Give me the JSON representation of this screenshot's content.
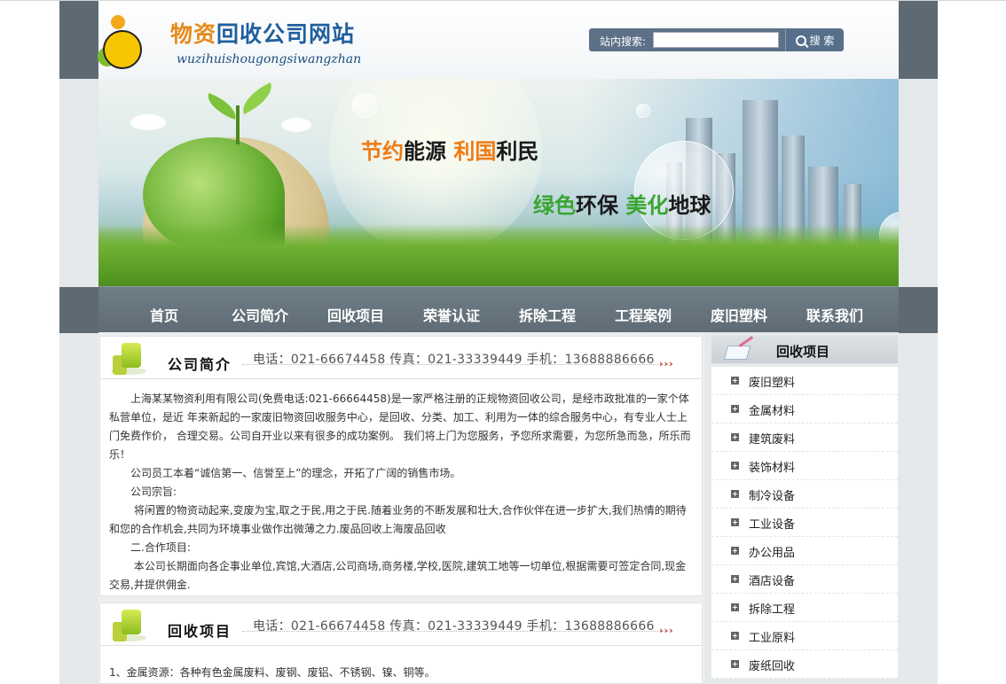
{
  "header": {
    "title_part1": "物资",
    "title_part2": "回收公司网站",
    "pinyin": "wuzihuishougongsiwangzhan",
    "search_label": "站内搜索:",
    "search_value": "",
    "search_button": "搜 索"
  },
  "banner": {
    "slogan1_a": "节约",
    "slogan1_b": "能源 ",
    "slogan1_c": "利国",
    "slogan1_d": "利民",
    "slogan2_a": "绿色",
    "slogan2_b": "环保 ",
    "slogan2_c": "美化",
    "slogan2_d": "地球"
  },
  "nav": {
    "items": [
      "首页",
      "公司简介",
      "回收项目",
      "荣誉认证",
      "拆除工程",
      "工程案例",
      "废旧塑料",
      "联系我们"
    ]
  },
  "about": {
    "title": "公司简介",
    "contact": "电话：021-66674458 传真：021-33339449 手机：13688886666",
    "arrows": "›››",
    "paragraphs": [
      "　　上海某某物资利用有限公司(免费电话:021-66664458)是一家严格注册的正规物资回收公司，是经市政批准的一家个体私营单位，是近 年来新起的一家废旧物资回收服务中心，是回收、分类、加工、利用为一体的综合服务中心，有专业人士上门免费作价， 合理交易。公司自开业以来有很多的成功案例。 我们将上门为您服务，予您所求需要，为您所急而急，所乐而乐！",
      "　　公司员工本着“诚信第一、信誉至上”的理念，开拓了广阔的销售市场。",
      "　　公司宗旨:",
      "　　 将闲置的物资动起来,变废为宝,取之于民,用之于民.随着业务的不断发展和壮大,合作伙伴在进一步扩大,我们热情的期待和您的合作机会,共同为环境事业做作出微薄之力.废品回收上海废品回收",
      "　　二.合作项目:",
      "　　 本公司长期面向各企事业单位,宾馆,大酒店,公司商场,商务楼,学校,医院,建筑工地等一切单位,根据需要可签定合同,现金交易,并提供佣金."
    ]
  },
  "projects": {
    "title": "回收项目",
    "contact": "电话：021-66674458 传真：021-33339449 手机：13688886666",
    "arrows": "›››",
    "line1": "1、金属资源：各种有色金属废料、废钢、废铝、不锈钢、镍、铜等。"
  },
  "sidebar": {
    "title": "回收项目",
    "items": [
      "废旧塑料",
      "金属材料",
      "建筑废料",
      "装饰材料",
      "制冷设备",
      "工业设备",
      "办公用品",
      "酒店设备",
      "拆除工程",
      "工业原料",
      "废纸回收"
    ]
  }
}
